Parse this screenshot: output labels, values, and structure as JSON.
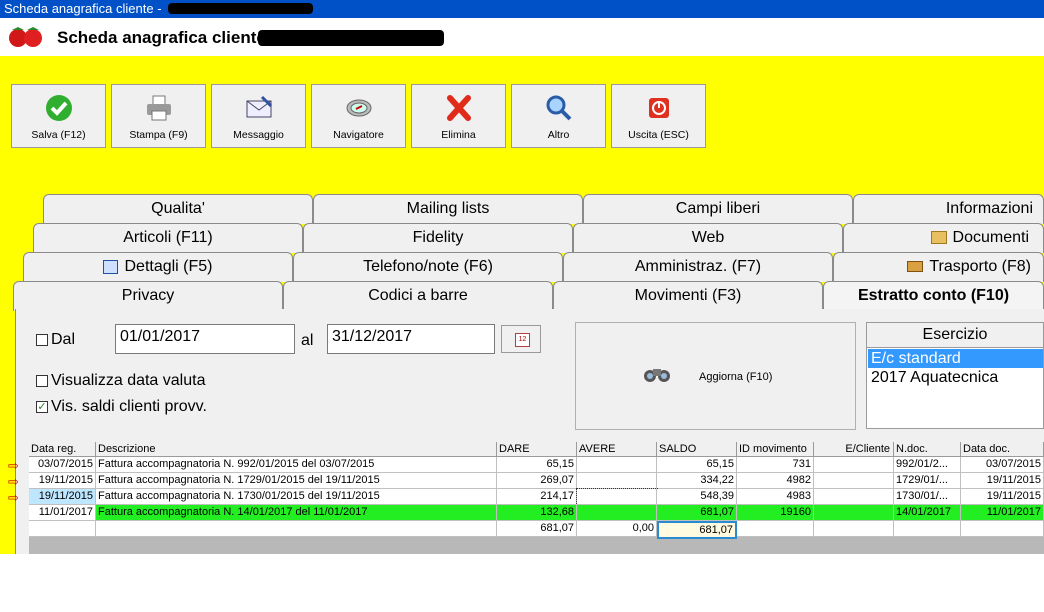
{
  "window": {
    "title": "Scheda anagrafica cliente - "
  },
  "header": {
    "title": "Scheda anagrafica cliente - "
  },
  "toolbar": [
    {
      "label": "Salva (F12)",
      "icon": "check-icon"
    },
    {
      "label": "Stampa (F9)",
      "icon": "printer-icon"
    },
    {
      "label": "Messaggio",
      "icon": "envelope-icon"
    },
    {
      "label": "Navigatore",
      "icon": "compass-icon"
    },
    {
      "label": "Elimina",
      "icon": "x-delete-icon"
    },
    {
      "label": "Altro",
      "icon": "magnifier-icon"
    },
    {
      "label": "Uscita (ESC)",
      "icon": "power-icon"
    }
  ],
  "tabs": {
    "row1": [
      "Qualita'",
      "Mailing lists",
      "Campi liberi",
      "Informazioni"
    ],
    "row2": [
      "Articoli (F11)",
      "Fidelity",
      "Web",
      "Documenti"
    ],
    "row3": [
      "Dettagli (F5)",
      "Telefono/note (F6)",
      "Amministraz. (F7)",
      "Trasporto (F8)"
    ],
    "row4": [
      "Privacy",
      "Codici a barre",
      "Movimenti (F3)",
      "Estratto conto (F10)"
    ]
  },
  "filters": {
    "dal_label": "Dal",
    "date_from": "01/01/2017",
    "al_label": "al",
    "date_to": "31/12/2017",
    "calendar_day": "12",
    "show_value_date": "Visualizza data valuta",
    "show_prov_balances": "Vis. saldi clienti provv.",
    "refresh_label": "Aggiorna (F10)"
  },
  "esercizio": {
    "header": "Esercizio",
    "options": [
      "E/c standard",
      "2017 Aquatecnica"
    ],
    "selected": "E/c standard"
  },
  "table": {
    "columns": [
      "Data reg.",
      "Descrizione",
      "DARE",
      "AVERE",
      "SALDO",
      "ID movimento",
      "E/Cliente",
      "N.doc.",
      "Data doc."
    ],
    "rows": [
      [
        "03/07/2015",
        "Fattura accompagnatoria N. 992/01/2015 del 03/07/2015",
        "65,15",
        "",
        "65,15",
        "731",
        "",
        "992/01/2...",
        "03/07/2015"
      ],
      [
        "19/11/2015",
        "Fattura accompagnatoria N. 1729/01/2015 del 19/11/2015",
        "269,07",
        "",
        "334,22",
        "4982",
        "",
        "1729/01/...",
        "19/11/2015"
      ],
      [
        "19/11/2015",
        "Fattura accompagnatoria N. 1730/01/2015 del 19/11/2015",
        "214,17",
        "",
        "548,39",
        "4983",
        "",
        "1730/01/...",
        "19/11/2015"
      ],
      [
        "11/01/2017",
        "Fattura accompagnatoria N. 14/01/2017 del 11/01/2017",
        "132,68",
        "",
        "681,07",
        "19160",
        "",
        "14/01/2017",
        "11/01/2017"
      ]
    ],
    "totals": {
      "dare": "681,07",
      "avere": "0,00",
      "saldo": "681,07"
    },
    "highlight_color": "#22ee22"
  }
}
